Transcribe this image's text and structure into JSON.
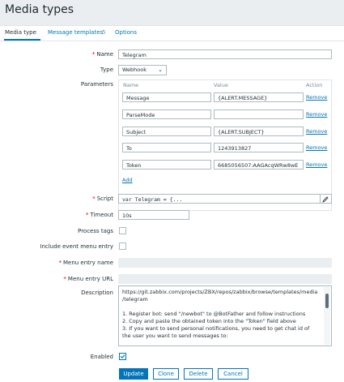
{
  "page": {
    "title": "Media types"
  },
  "tabs": [
    {
      "label": "Media type"
    },
    {
      "label": "Message templates"
    },
    {
      "label": "5"
    },
    {
      "label": "Options"
    }
  ],
  "form": {
    "name": {
      "label": "Name",
      "value": "Telegram"
    },
    "type": {
      "label": "Type",
      "value": "Webhook"
    },
    "parameters": {
      "label": "Parameters",
      "header_name": "Name",
      "header_value": "Value",
      "header_action": "Action",
      "rows": [
        {
          "name": "Message",
          "value": "{ALERT.MESSAGE}",
          "action": "Remove"
        },
        {
          "name": "ParseMode",
          "value": "",
          "action": "Remove"
        },
        {
          "name": "Subject",
          "value": "{ALERT.SUBJECT}",
          "action": "Remove"
        },
        {
          "name": "To",
          "value": "1243913827",
          "action": "Remove"
        },
        {
          "name": "Token",
          "value": "6685056507:AAGAcqWRw8wE",
          "action": "Remove"
        }
      ],
      "add_label": "Add"
    },
    "script": {
      "label": "Script",
      "value": "var Telegram = {..."
    },
    "timeout": {
      "label": "Timeout",
      "value": "10s"
    },
    "process_tags": {
      "label": "Process tags"
    },
    "include_event_menu_entry": {
      "label": "Include event menu entry"
    },
    "menu_entry_name": {
      "label": "Menu entry name"
    },
    "menu_entry_url": {
      "label": "Menu entry URL"
    },
    "description": {
      "label": "Description",
      "lines": [
        "https://git.zabbix.com/projects/ZBX/repos/zabbix/browse/templates/media",
        "/telegram",
        "",
        "1. Register bot: send \"/newbot\" to @BotFather and follow instructions",
        "2. Copy and paste the obtained token into the \"Token\" field above",
        "3. If you want to send personal notifications, you need to get chat id of",
        "the user you want to send messages to:"
      ]
    },
    "enabled": {
      "label": "Enabled",
      "checked": true
    }
  },
  "buttons": {
    "update": "Update",
    "clone": "Clone",
    "delete": "Delete",
    "cancel": "Cancel"
  },
  "colors": {
    "accent": "#0275b8",
    "required": "#d40000"
  },
  "icons": {
    "type_dropdown": "chevron-down-icon",
    "script_edit": "pencil-icon",
    "enabled": "checkmark-icon"
  }
}
